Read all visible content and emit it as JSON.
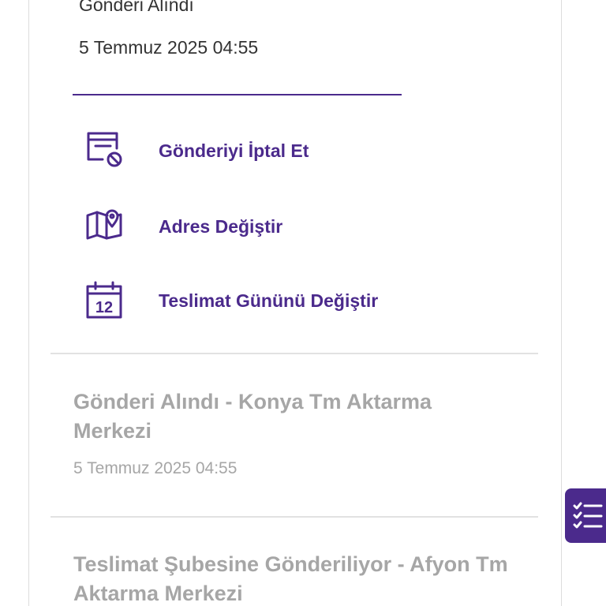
{
  "current_event": {
    "status": "Gönderi Alındı",
    "date": "5 Temmuz 2025 04:55"
  },
  "actions": [
    {
      "label": "Gönderiyi İptal Et",
      "icon": "cancel-shipment-icon"
    },
    {
      "label": "Adres Değiştir",
      "icon": "map-pin-icon"
    },
    {
      "label": "Teslimat Gününü Değiştir",
      "icon": "calendar-icon"
    }
  ],
  "history": [
    {
      "title": "Gönderi Alındı - Konya Tm Aktarma Merkezi",
      "date": "5 Temmuz 2025 04:55"
    },
    {
      "title": "Teslimat Şubesine Gönderiliyor - Afyon Tm Aktarma Merkezi"
    }
  ],
  "calendar_icon_day": "12",
  "colors": {
    "accent": "#4b2a8c",
    "muted_text": "#a6a6a6",
    "body_text": "#333333",
    "divider": "#e2e2e2"
  },
  "fab": {
    "icon": "checklist-icon"
  }
}
